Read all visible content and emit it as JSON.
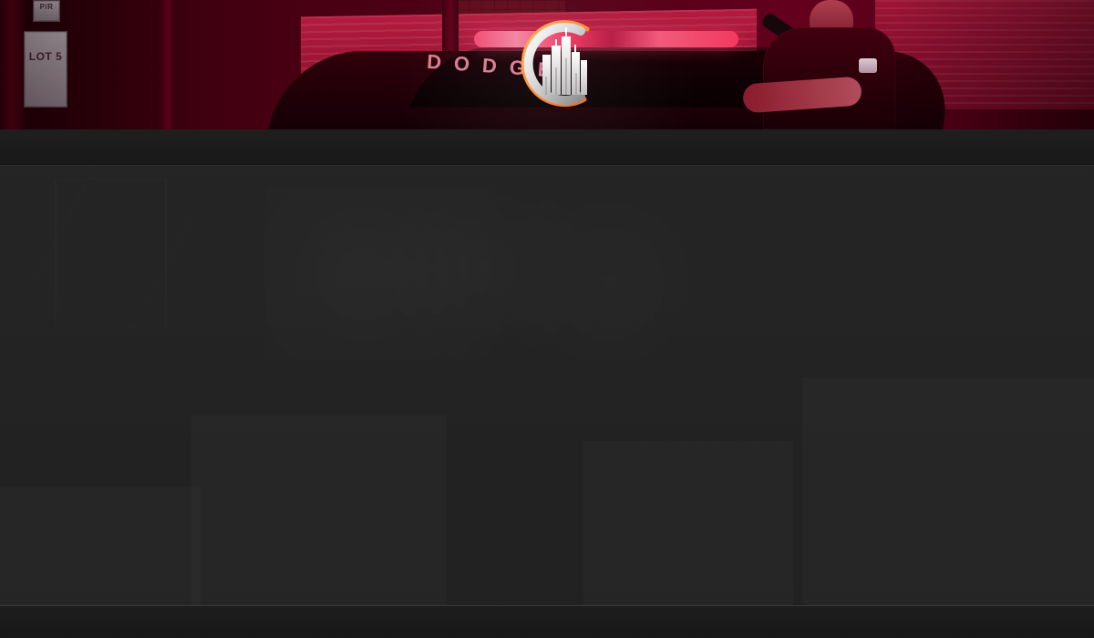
{
  "hero": {
    "sign_top": "P/R",
    "sign_lot": "LOT 5",
    "car_text": "DODGE"
  },
  "colors": {
    "hero_red": "#5a0018",
    "hero_highlight": "#ff4e78",
    "logo_orange": "#ff7a1a",
    "logo_silver": "#e7e7e7",
    "nav_bg": "#1b1b1b",
    "main_bg": "#222222",
    "footer_bg": "#1a1a1a"
  },
  "icons": {
    "logo": "city-skyline-logo-icon"
  }
}
